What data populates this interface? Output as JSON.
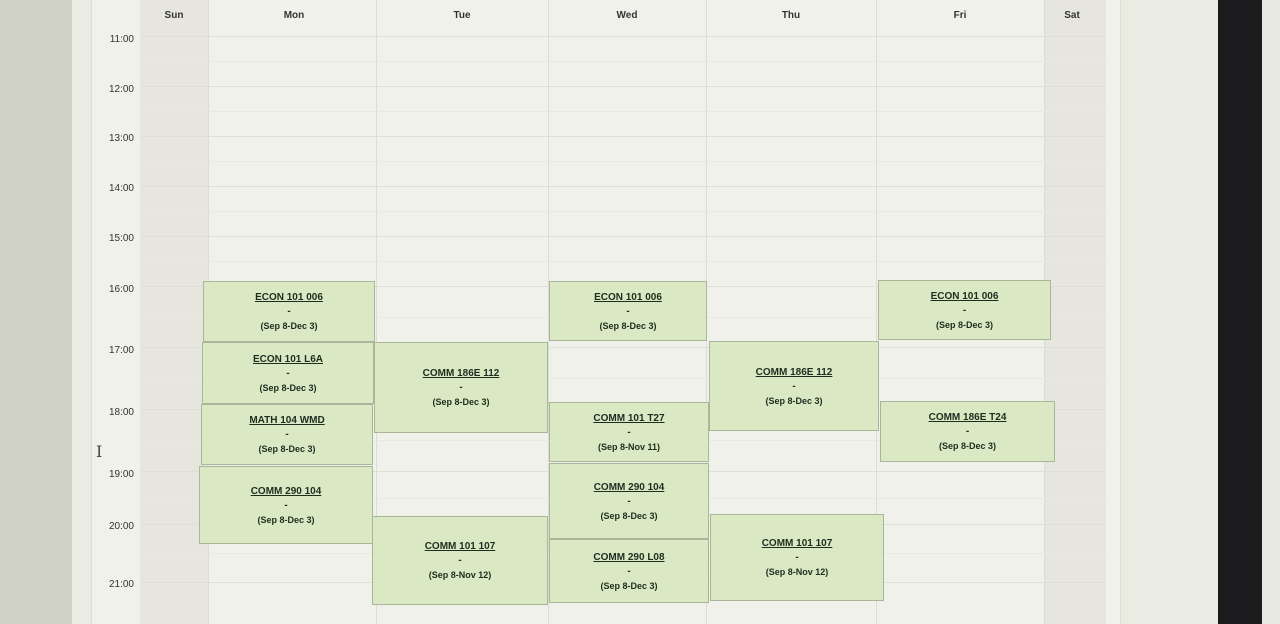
{
  "days": [
    "Sun",
    "Mon",
    "Tue",
    "Wed",
    "Thu",
    "Fri",
    "Sat"
  ],
  "times": [
    "11:00",
    "12:00",
    "13:00",
    "14:00",
    "15:00",
    "16:00",
    "17:00",
    "18:00",
    "19:00",
    "20:00",
    "21:00"
  ],
  "events": [
    {
      "day": "Mon",
      "code": "ECON 101 006",
      "dash": "-",
      "dates": "(Sep 8-Dec 3)"
    },
    {
      "day": "Mon",
      "code": "ECON 101 L6A",
      "dash": "-",
      "dates": "(Sep 8-Dec 3)"
    },
    {
      "day": "Mon",
      "code": "MATH 104 WMD",
      "dash": "-",
      "dates": "(Sep 8-Dec 3)"
    },
    {
      "day": "Mon",
      "code": "COMM 290 104",
      "dash": "-",
      "dates": "(Sep 8-Dec 3)"
    },
    {
      "day": "Tue",
      "code": "COMM 186E 112",
      "dash": "-",
      "dates": "(Sep 8-Dec 3)"
    },
    {
      "day": "Tue",
      "code": "COMM 101 107",
      "dash": "-",
      "dates": "(Sep 8-Nov 12)"
    },
    {
      "day": "Wed",
      "code": "ECON 101 006",
      "dash": "-",
      "dates": "(Sep 8-Dec 3)"
    },
    {
      "day": "Wed",
      "code": "COMM 101 T27",
      "dash": "-",
      "dates": "(Sep 8-Nov 11)"
    },
    {
      "day": "Wed",
      "code": "COMM 290 104",
      "dash": "-",
      "dates": "(Sep 8-Dec 3)"
    },
    {
      "day": "Wed",
      "code": "COMM 290 L08",
      "dash": "-",
      "dates": "(Sep 8-Dec 3)"
    },
    {
      "day": "Thu",
      "code": "COMM 186E 112",
      "dash": "-",
      "dates": "(Sep 8-Dec 3)"
    },
    {
      "day": "Thu",
      "code": "COMM 101 107",
      "dash": "-",
      "dates": "(Sep 8-Nov 12)"
    },
    {
      "day": "Fri",
      "code": "ECON 101 006",
      "dash": "-",
      "dates": "(Sep 8-Dec 3)"
    },
    {
      "day": "Fri",
      "code": "COMM 186E T24",
      "dash": "-",
      "dates": "(Sep 8-Dec 3)"
    }
  ]
}
